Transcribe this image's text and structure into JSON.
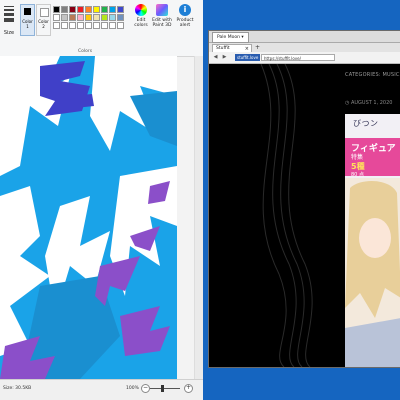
{
  "paint": {
    "size_label": "Size",
    "color1_label": "Color 1",
    "color2_label": "Color 2",
    "edit_colors_label": "Edit colors",
    "edit_paint3d_label": "Edit with Paint 3D",
    "product_alert_label": "Product alert",
    "colors_section_label": "Colors",
    "status_size": "Size: 30.5KB",
    "zoom_level": "100%",
    "color1": "#000000",
    "color2": "#ffffff",
    "palette": [
      "#000000",
      "#7f7f7f",
      "#880015",
      "#ed1c24",
      "#ff7f27",
      "#fff200",
      "#22b14c",
      "#00a2e8",
      "#3f48cc",
      "#ffffff",
      "#c3c3c3",
      "#b97a57",
      "#ffaec9",
      "#ffc90e",
      "#efe4b0",
      "#b5e61d",
      "#99d9ea",
      "#7092be",
      "#ffffff",
      "#ffffff",
      "#ffffff",
      "#ffffff",
      "#ffffff",
      "#ffffff",
      "#ffffff",
      "#ffffff",
      "#ffffff"
    ]
  },
  "browser": {
    "app_name": "Pale Moon",
    "tab_title": "Stuffit",
    "new_tab": "+",
    "site_badge": "stuffit.love",
    "url": "https://stuffit.love/",
    "category": "CATEGORIES: MUSIC",
    "date": "AUGUST 1, 2020",
    "post_head": "びつン",
    "post_l1": "フィギュア",
    "post_l2": "特集",
    "post_l3": "5種",
    "post_l4": "80 点"
  }
}
